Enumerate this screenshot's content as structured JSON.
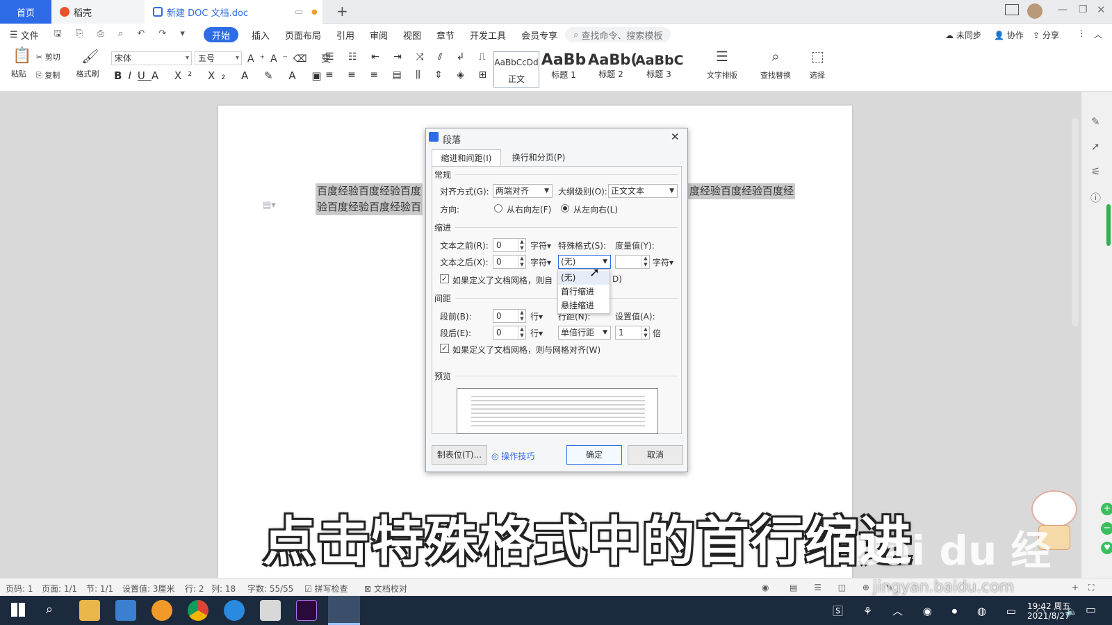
{
  "tabs": {
    "home": "首页",
    "docer": "稻壳",
    "doc": "新建 DOC 文档.doc",
    "new_tab": "+"
  },
  "menu": {
    "file": "文件",
    "start": "开始",
    "insert": "插入",
    "layout": "页面布局",
    "reference": "引用",
    "review": "审阅",
    "view": "视图",
    "chapter": "章节",
    "devtools": "开发工具",
    "vip": "会员专享",
    "search": "查找命令、搜索模板",
    "unsync": "未同步",
    "collab": "协作",
    "share": "分享"
  },
  "toolbar": {
    "paste": "粘贴",
    "cut": "剪切",
    "copy": "复制",
    "format_painter": "格式刷",
    "font": "宋体",
    "size": "五号",
    "styles": [
      {
        "preview": "AaBbCcDd",
        "name": "正文"
      },
      {
        "preview": "AaBb",
        "name": "标题 1"
      },
      {
        "preview": "AaBb(",
        "name": "标题 2"
      },
      {
        "preview": "AaBbC",
        "name": "标题 3"
      }
    ],
    "text_layout": "文字排版",
    "find_replace": "查找替换",
    "select": "选择"
  },
  "document": {
    "line1": "百度经验百度经验百度",
    "line1_right": "度经验百度经验百度经",
    "line2": "验百度经验百度经验百"
  },
  "dialog": {
    "title": "段落",
    "close": "✕",
    "tab1": "缩进和间距(I)",
    "tab2": "换行和分页(P)",
    "general": "常规",
    "align_label": "对齐方式(G):",
    "align_value": "两端对齐",
    "outline_label": "大纲级别(O):",
    "outline_value": "正文文本",
    "direction_label": "方向:",
    "rtl": "从右向左(F)",
    "ltr": "从左向右(L)",
    "indent": "缩进",
    "before_label": "文本之前(R):",
    "before_value": "0",
    "unit_char": "字符",
    "after_label": "文本之后(X):",
    "after_value": "0",
    "special_label": "特殊格式(S):",
    "special_value": "(无)",
    "measure_label": "度量值(Y):",
    "measure_value": "",
    "grid_indent_text": "如果定义了文档网格，则自",
    "grid_indent_tail": "D)",
    "spacing": "间距",
    "space_before_label": "段前(B):",
    "space_before_value": "0",
    "unit_line": "行",
    "space_after_label": "段后(E):",
    "space_after_value": "0",
    "line_spacing_label": "行距(N):",
    "line_spacing_value": "单倍行距",
    "set_value_label": "设置值(A):",
    "set_value": "1",
    "unit_times": "倍",
    "grid_align_text": "如果定义了文档网格，则与网格对齐(W)",
    "preview": "预览",
    "tab_stops": "制表位(T)...",
    "tips": "操作技巧",
    "ok": "确定",
    "cancel": "取消",
    "dropdown": [
      "(无)",
      "首行缩进",
      "悬挂缩进"
    ]
  },
  "status": {
    "page": "页码: 1",
    "pages": "页面: 1/1",
    "section": "节: 1/1",
    "setting": "设置值: 3厘米",
    "row": "行: 2",
    "col": "列: 18",
    "words": "字数: 55/55",
    "spell": "拼写检查",
    "proof": "文档校对"
  },
  "subtitle": "点击特殊格式中的首行缩进",
  "watermark": "Bai du 经验",
  "watermark_url": "jingyan.baidu.com",
  "clock": {
    "time": "19:42 周五",
    "date": "2021/8/27"
  }
}
